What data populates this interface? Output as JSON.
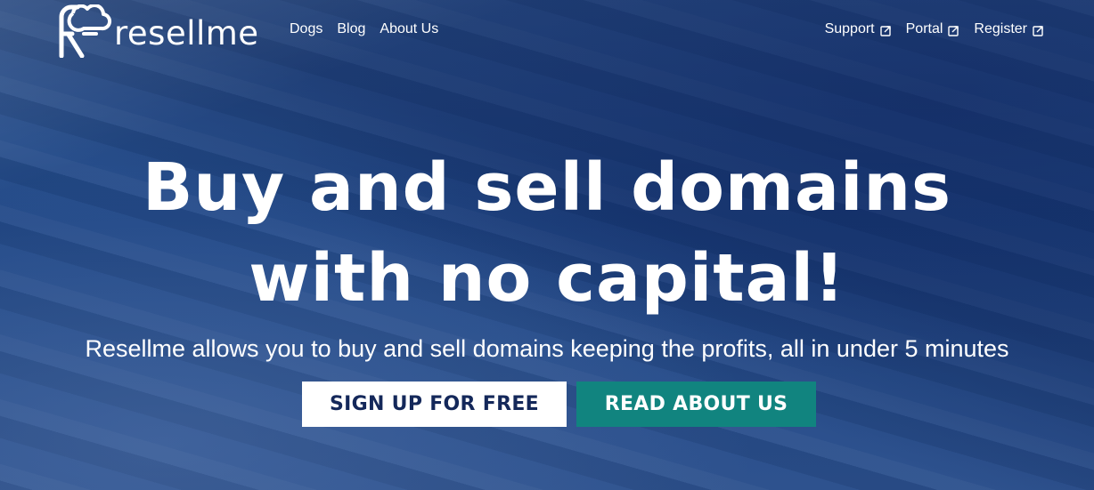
{
  "brand": {
    "name": "resellme",
    "logo_icon": "cloud-r-logo-icon"
  },
  "nav": {
    "left": [
      "Dogs",
      "Blog",
      "About Us"
    ],
    "right": [
      "Support",
      "Portal",
      "Register"
    ],
    "external_icon": "external-link-icon"
  },
  "hero": {
    "headline_line1": "Buy and sell domains",
    "headline_line2": "with no capital!",
    "subtitle": "Resellme allows you to buy and sell domains keeping the profits, all in under 5 minutes",
    "primary_cta": "SIGN UP FOR FREE",
    "secondary_cta": "READ ABOUT US"
  },
  "colors": {
    "background": "#1f4686",
    "primary_cta_bg": "#ffffff",
    "primary_cta_text": "#14285a",
    "secondary_cta_bg": "#11847f",
    "text": "#ffffff"
  }
}
